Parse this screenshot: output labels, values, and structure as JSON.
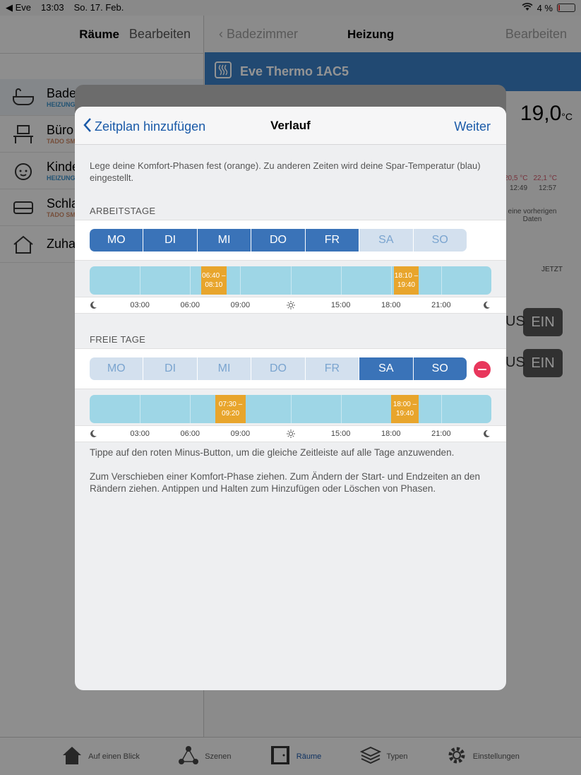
{
  "statusbar": {
    "back_app": "◀ Eve",
    "time": "13:03",
    "date": "So. 17. Feb.",
    "battery": "4 %"
  },
  "left_pane": {
    "title": "Räume",
    "edit": "Bearbeiten",
    "rooms": [
      {
        "name": "Bade",
        "sub": "HEIZUNG"
      },
      {
        "name": "Büro",
        "sub": "TADO SM"
      },
      {
        "name": "Kinde",
        "sub": "HEIZUNG"
      },
      {
        "name": "Schla",
        "sub": "TADO SM"
      },
      {
        "name": "Zuha",
        "sub": ""
      }
    ]
  },
  "right_pane": {
    "back": "Badezimmer",
    "title": "Heizung",
    "edit": "Bearbeiten",
    "device_name": "Eve Thermo 1AC5",
    "temperature": "19,0",
    "temp_unit": "°C",
    "chart_val_1": "20,5 °C",
    "chart_val_2": "22,1 °C",
    "chart_time_1": "12:49",
    "chart_time_2": "12:57",
    "no_data": "eine vorherigen Daten",
    "jetzt": "JETZT",
    "btn_partial_1": "US",
    "btn_ein_1": "EIN",
    "btn_partial_2": "US",
    "btn_ein_2": "EIN"
  },
  "tabbar": {
    "tabs": [
      {
        "label": "Auf einen Blick"
      },
      {
        "label": "Szenen"
      },
      {
        "label": "Räume"
      },
      {
        "label": "Typen"
      },
      {
        "label": "Einstellungen"
      }
    ]
  },
  "modal": {
    "back_label": "Zeitplan hinzufügen",
    "title": "Verlauf",
    "next_label": "Weiter",
    "intro": "Lege deine Komfort-Phasen fest (orange). Zu anderen Zeiten wird deine Spar-Temperatur (blau) eingestellt.",
    "workdays": {
      "label": "ARBEITSTAGE",
      "days": [
        {
          "label": "MO",
          "active": true
        },
        {
          "label": "DI",
          "active": true
        },
        {
          "label": "MI",
          "active": true
        },
        {
          "label": "DO",
          "active": true
        },
        {
          "label": "FR",
          "active": true
        },
        {
          "label": "SA",
          "active": false
        },
        {
          "label": "SO",
          "active": false
        }
      ],
      "phases": [
        {
          "start": "06:40",
          "end": "08:10",
          "text1": "06:40 –",
          "text2": "08:10"
        },
        {
          "start": "18:10",
          "end": "19:40",
          "text1": "18:10 –",
          "text2": "19:40"
        }
      ]
    },
    "freedays": {
      "label": "FREIE TAGE",
      "days": [
        {
          "label": "MO",
          "active": false
        },
        {
          "label": "DI",
          "active": false
        },
        {
          "label": "MI",
          "active": false
        },
        {
          "label": "DO",
          "active": false
        },
        {
          "label": "FR",
          "active": false
        },
        {
          "label": "SA",
          "active": true
        },
        {
          "label": "SO",
          "active": true
        }
      ],
      "phases": [
        {
          "start": "07:30",
          "end": "09:20",
          "text1": "07:30 –",
          "text2": "09:20"
        },
        {
          "start": "18:00",
          "end": "19:40",
          "text1": "18:00 –",
          "text2": "19:40"
        }
      ]
    },
    "axis_ticks": [
      {
        "hour": 0,
        "kind": "moon"
      },
      {
        "hour": 3,
        "text": "03:00"
      },
      {
        "hour": 6,
        "text": "06:00"
      },
      {
        "hour": 9,
        "text": "09:00"
      },
      {
        "hour": 12,
        "kind": "sun"
      },
      {
        "hour": 15,
        "text": "15:00"
      },
      {
        "hour": 18,
        "text": "18:00"
      },
      {
        "hour": 21,
        "text": "21:00"
      },
      {
        "hour": 24,
        "kind": "moon"
      }
    ],
    "help_1": "Tippe auf den roten Minus-Button, um die gleiche Zeitleiste auf alle Tage anzuwenden.",
    "help_2": "Zum Verschieben einer Komfort-Phase ziehen. Zum Ändern der Start- und Endzeiten an den Rändern ziehen. Antippen und Halten zum Hinzufügen oder Löschen von Phasen."
  },
  "colors": {
    "accent": "#1a5aa8",
    "day_on": "#3a73b8",
    "day_off": "#d3e0ee",
    "eco": "#9ed6e6",
    "comfort": "#e8a52c",
    "minus": "#e8375c"
  }
}
